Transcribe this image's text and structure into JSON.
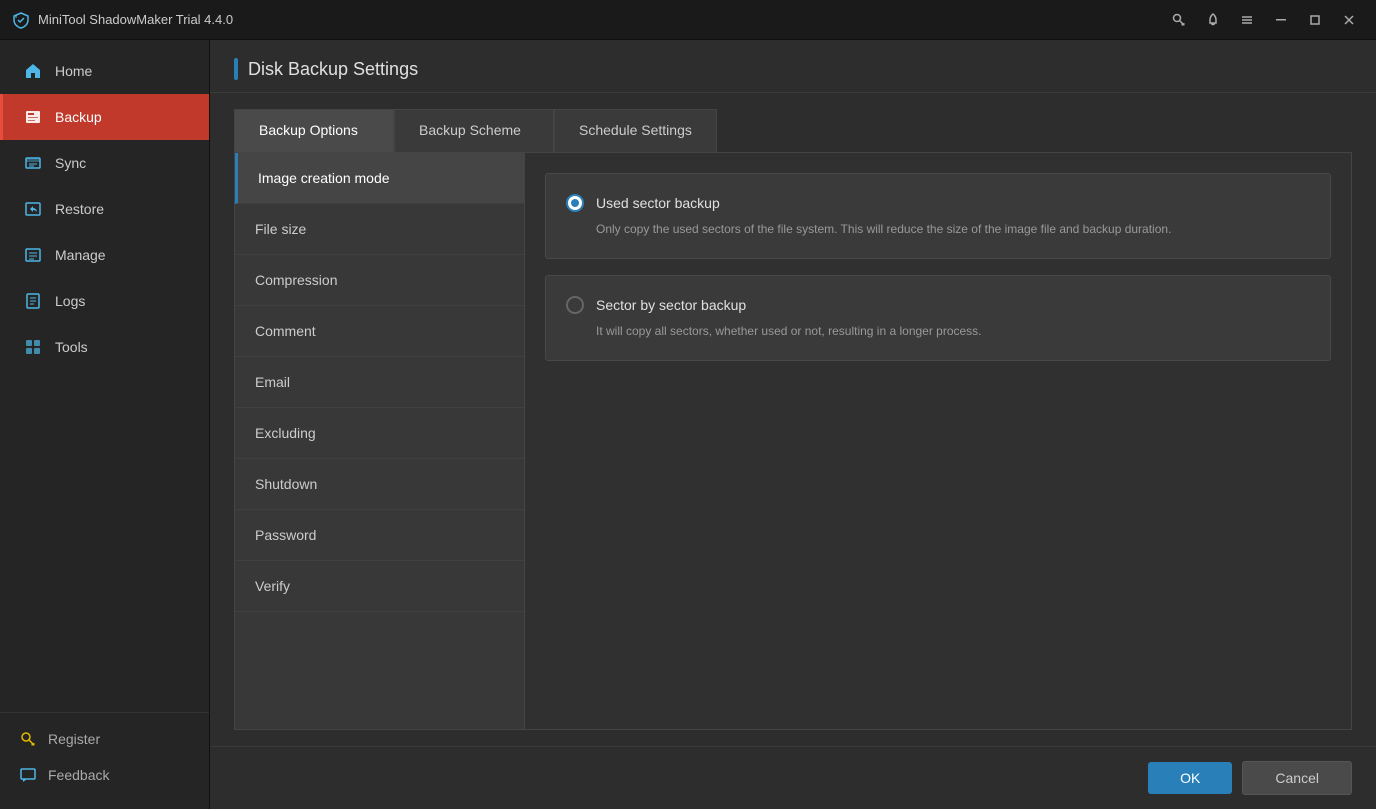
{
  "app": {
    "title": "MiniTool ShadowMaker Trial 4.4.0"
  },
  "titlebar": {
    "key_icon": "🔑",
    "bell_icon": "🔔",
    "menu_icon": "☰",
    "minimize_icon": "─",
    "maximize_icon": "□",
    "close_icon": "✕"
  },
  "sidebar": {
    "items": [
      {
        "id": "home",
        "label": "Home",
        "icon": "home"
      },
      {
        "id": "backup",
        "label": "Backup",
        "icon": "backup",
        "active": true
      },
      {
        "id": "sync",
        "label": "Sync",
        "icon": "sync"
      },
      {
        "id": "restore",
        "label": "Restore",
        "icon": "restore"
      },
      {
        "id": "manage",
        "label": "Manage",
        "icon": "manage"
      },
      {
        "id": "logs",
        "label": "Logs",
        "icon": "logs"
      },
      {
        "id": "tools",
        "label": "Tools",
        "icon": "tools"
      }
    ],
    "bottom": [
      {
        "id": "register",
        "label": "Register",
        "icon": "key"
      },
      {
        "id": "feedback",
        "label": "Feedback",
        "icon": "feedback"
      }
    ]
  },
  "page": {
    "title": "Disk Backup Settings"
  },
  "tabs": [
    {
      "id": "backup-options",
      "label": "Backup Options",
      "active": true
    },
    {
      "id": "backup-scheme",
      "label": "Backup Scheme"
    },
    {
      "id": "schedule-settings",
      "label": "Schedule Settings"
    }
  ],
  "options_list": [
    {
      "id": "image-creation-mode",
      "label": "Image creation mode",
      "active": true
    },
    {
      "id": "file-size",
      "label": "File size"
    },
    {
      "id": "compression",
      "label": "Compression"
    },
    {
      "id": "comment",
      "label": "Comment"
    },
    {
      "id": "email",
      "label": "Email"
    },
    {
      "id": "excluding",
      "label": "Excluding"
    },
    {
      "id": "shutdown",
      "label": "Shutdown"
    },
    {
      "id": "password",
      "label": "Password"
    },
    {
      "id": "verify",
      "label": "Verify"
    }
  ],
  "settings": {
    "active_option": "image-creation-mode",
    "radio_options": [
      {
        "id": "used-sector",
        "label": "Used sector backup",
        "description": "Only copy the used sectors of the file system. This will reduce the size of the image file and backup duration.",
        "checked": true
      },
      {
        "id": "sector-by-sector",
        "label": "Sector by sector backup",
        "description": "It will copy all sectors, whether used or not, resulting in a longer process.",
        "checked": false
      }
    ]
  },
  "footer": {
    "ok_label": "OK",
    "cancel_label": "Cancel"
  }
}
